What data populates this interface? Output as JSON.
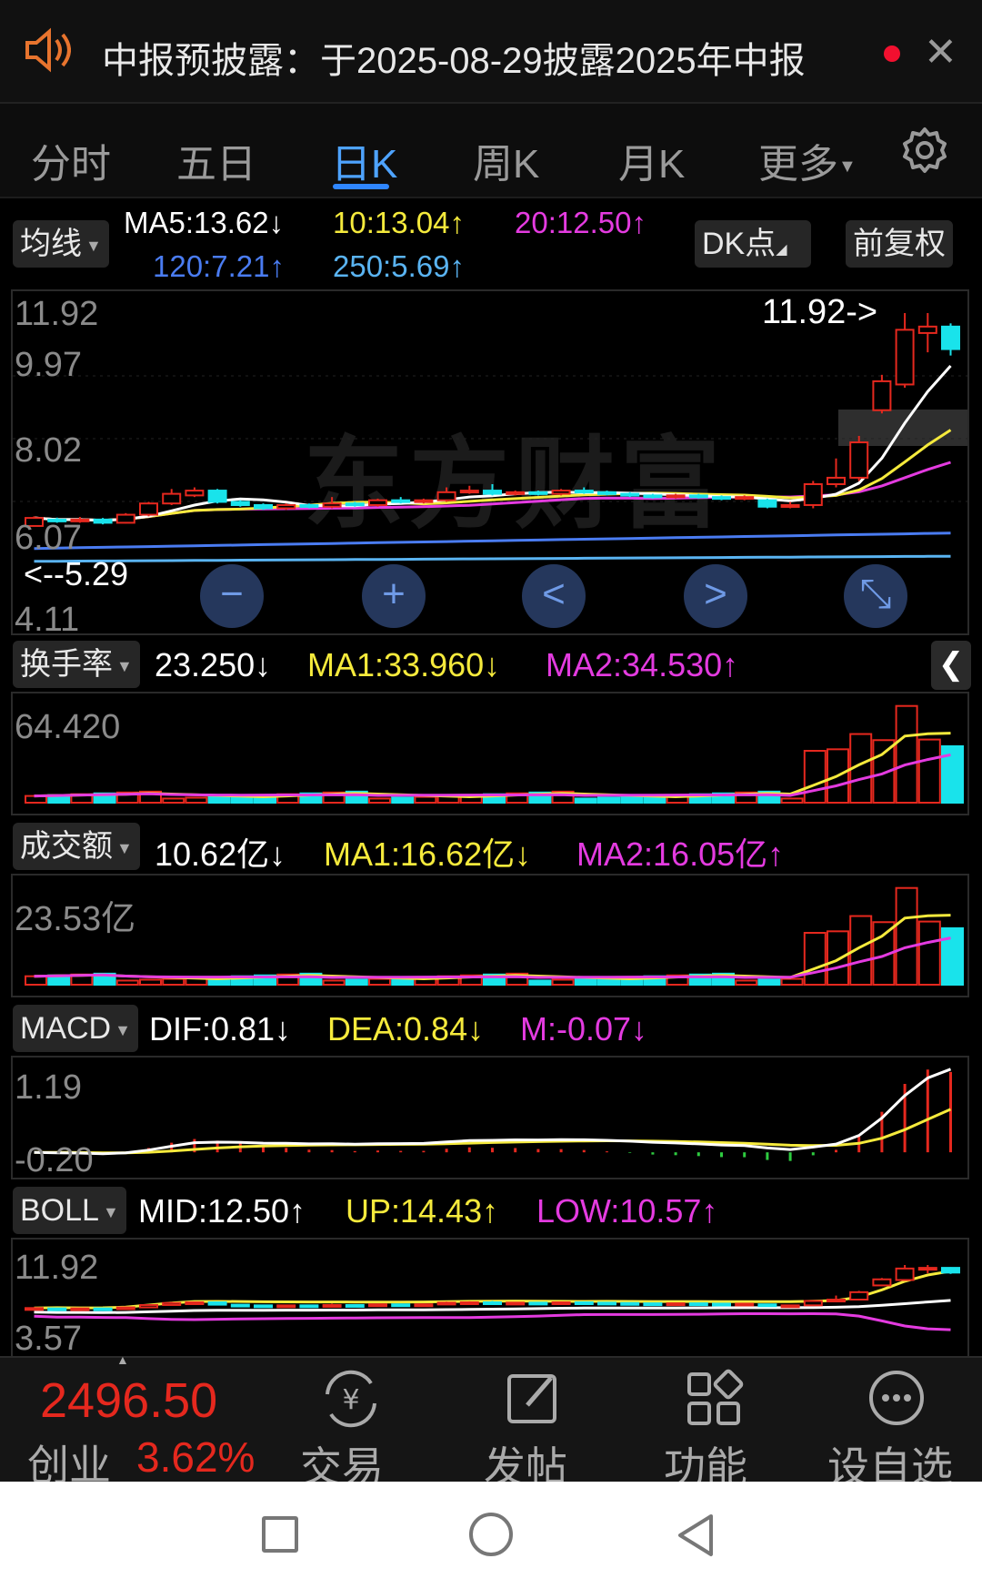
{
  "notice": {
    "icon": "speaker-icon",
    "text": "中报预披露：于2025-08-29披露2025年中报",
    "close": "✕"
  },
  "tabs": [
    "分时",
    "五日",
    "日K",
    "周K",
    "月K",
    "更多"
  ],
  "active_tab": "日K",
  "ma_selector": "均线",
  "ma_values": {
    "ma5": "MA5:13.62↓",
    "ma10": "10:13.04↑",
    "ma20": "20:12.50↑",
    "ma120": "120:7.21↑",
    "ma250": "250:5.69↑"
  },
  "dk_button": "DK点",
  "fq_button": "前复权",
  "watermark": "东方财富",
  "price_axis": [
    "11.92",
    "9.97",
    "8.02",
    "6.07",
    "4.11"
  ],
  "max_label": "11.92->",
  "min_label": "<--5.29",
  "nav_buttons": [
    "−",
    "+",
    "<",
    ">",
    "⤡"
  ],
  "turnover": {
    "selector": "换手率",
    "value": "23.250↓",
    "ma1": "MA1:33.960↓",
    "ma2": "MA2:34.530↑",
    "max": "64.420"
  },
  "amount": {
    "selector": "成交额",
    "value": "10.62亿↓",
    "ma1": "MA1:16.62亿↓",
    "ma2": "MA2:16.05亿↑",
    "max": "23.53亿"
  },
  "macd": {
    "selector": "MACD",
    "dif": "DIF:0.81↓",
    "dea": "DEA:0.84↓",
    "m": "M:-0.07↓",
    "top": "1.19",
    "bottom": "-0.20"
  },
  "boll": {
    "selector": "BOLL",
    "mid": "MID:12.50↑",
    "up": "UP:14.43↑",
    "low": "LOW:10.57↑",
    "top": "11.92",
    "bottom": "3.57"
  },
  "index": {
    "price": "2496.50",
    "name": "创业",
    "change": "3.62%"
  },
  "bottom_nav": [
    {
      "label": "交易",
      "icon": "yen-exchange-icon"
    },
    {
      "label": "发帖",
      "icon": "edit-icon"
    },
    {
      "label": "功能",
      "icon": "grid-icon"
    },
    {
      "label": "设自选",
      "icon": "more-icon"
    }
  ],
  "colors": {
    "up": "#e5281e",
    "down": "#19e3eb",
    "ma5": "#ffffff",
    "ma10": "#f5ea3c",
    "ma20": "#e43be0",
    "ma120": "#4a7cf2",
    "ma250": "#5ab4f2",
    "accent": "#2f86ff"
  },
  "chart_data": {
    "type": "candlestick",
    "title": "",
    "ylim": [
      4.11,
      11.92
    ],
    "candles": [
      {
        "o": 5.3,
        "c": 5.55,
        "h": 5.6,
        "l": 5.29
      },
      {
        "o": 5.5,
        "c": 5.45,
        "h": 5.56,
        "l": 5.4
      },
      {
        "o": 5.45,
        "c": 5.5,
        "h": 5.58,
        "l": 5.4
      },
      {
        "o": 5.5,
        "c": 5.4,
        "h": 5.55,
        "l": 5.35
      },
      {
        "o": 5.4,
        "c": 5.65,
        "h": 5.7,
        "l": 5.38
      },
      {
        "o": 5.65,
        "c": 6.0,
        "h": 6.05,
        "l": 5.6
      },
      {
        "o": 6.0,
        "c": 6.3,
        "h": 6.45,
        "l": 5.95
      },
      {
        "o": 6.25,
        "c": 6.4,
        "h": 6.5,
        "l": 6.2
      },
      {
        "o": 6.4,
        "c": 6.05,
        "h": 6.45,
        "l": 6.0
      },
      {
        "o": 6.05,
        "c": 5.95,
        "h": 6.1,
        "l": 5.9
      },
      {
        "o": 5.95,
        "c": 5.85,
        "h": 6.0,
        "l": 5.8
      },
      {
        "o": 5.85,
        "c": 5.95,
        "h": 6.0,
        "l": 5.8
      },
      {
        "o": 5.95,
        "c": 5.9,
        "h": 6.0,
        "l": 5.85
      },
      {
        "o": 5.9,
        "c": 6.0,
        "h": 6.2,
        "l": 5.85
      },
      {
        "o": 6.0,
        "c": 5.95,
        "h": 6.05,
        "l": 5.9
      },
      {
        "o": 5.95,
        "c": 6.1,
        "h": 6.15,
        "l": 5.9
      },
      {
        "o": 6.1,
        "c": 6.05,
        "h": 6.2,
        "l": 6.0
      },
      {
        "o": 6.05,
        "c": 6.1,
        "h": 6.15,
        "l": 6.0
      },
      {
        "o": 6.1,
        "c": 6.35,
        "h": 6.5,
        "l": 6.05
      },
      {
        "o": 6.35,
        "c": 6.4,
        "h": 6.55,
        "l": 6.3
      },
      {
        "o": 6.4,
        "c": 6.3,
        "h": 6.6,
        "l": 6.25
      },
      {
        "o": 6.3,
        "c": 6.35,
        "h": 6.4,
        "l": 6.25
      },
      {
        "o": 6.35,
        "c": 6.3,
        "h": 6.4,
        "l": 6.25
      },
      {
        "o": 6.3,
        "c": 6.4,
        "h": 6.45,
        "l": 6.25
      },
      {
        "o": 6.4,
        "c": 6.35,
        "h": 6.5,
        "l": 6.3
      },
      {
        "o": 6.35,
        "c": 6.3,
        "h": 6.4,
        "l": 6.25
      },
      {
        "o": 6.3,
        "c": 6.25,
        "h": 6.35,
        "l": 6.2
      },
      {
        "o": 6.25,
        "c": 6.2,
        "h": 6.3,
        "l": 6.15
      },
      {
        "o": 6.2,
        "c": 6.25,
        "h": 6.3,
        "l": 6.15
      },
      {
        "o": 6.25,
        "c": 6.2,
        "h": 6.3,
        "l": 6.15
      },
      {
        "o": 6.2,
        "c": 6.15,
        "h": 6.25,
        "l": 6.1
      },
      {
        "o": 6.15,
        "c": 6.2,
        "h": 6.25,
        "l": 6.1
      },
      {
        "o": 6.1,
        "c": 5.9,
        "h": 6.15,
        "l": 5.85
      },
      {
        "o": 5.9,
        "c": 5.95,
        "h": 6.05,
        "l": 5.85
      },
      {
        "o": 5.95,
        "c": 6.6,
        "h": 6.7,
        "l": 5.85
      },
      {
        "o": 6.6,
        "c": 6.8,
        "h": 7.4,
        "l": 6.5
      },
      {
        "o": 6.8,
        "c": 7.9,
        "h": 8.1,
        "l": 6.7
      },
      {
        "o": 8.9,
        "c": 9.8,
        "h": 10.0,
        "l": 8.8
      },
      {
        "o": 9.7,
        "c": 11.4,
        "h": 11.92,
        "l": 9.6
      },
      {
        "o": 11.3,
        "c": 11.5,
        "h": 11.92,
        "l": 10.7
      },
      {
        "o": 11.5,
        "c": 10.8,
        "h": 11.6,
        "l": 10.6
      }
    ],
    "turnover_max": 64.42,
    "amount_max": 23.53,
    "macd_range": [
      -0.2,
      1.19
    ]
  }
}
